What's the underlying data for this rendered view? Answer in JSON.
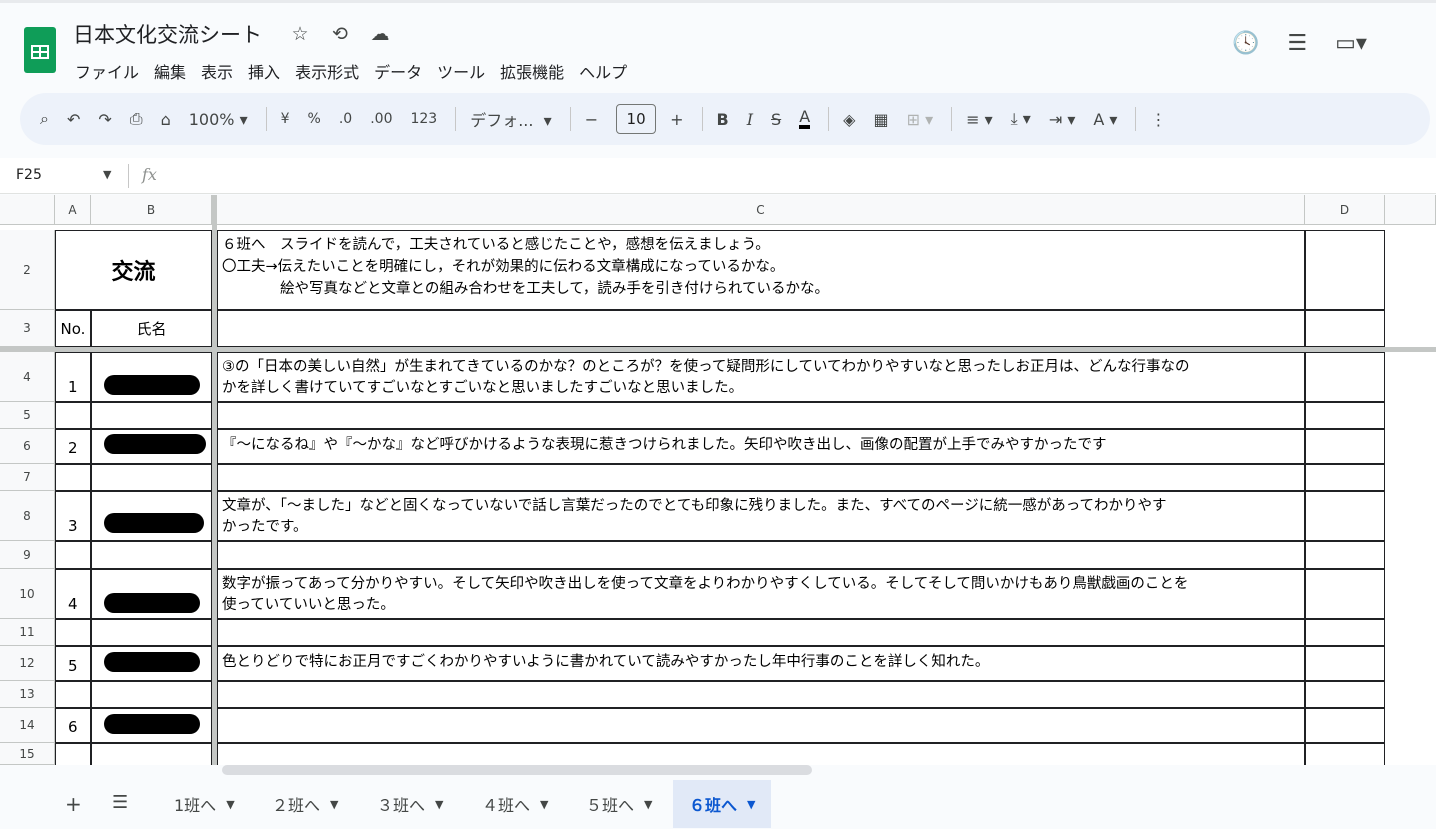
{
  "app": {
    "title": "日本文化交流シート",
    "icons": [
      "star-icon",
      "move-to-drive-icon",
      "cloud-status-icon"
    ]
  },
  "menu": [
    "ファイル",
    "編集",
    "表示",
    "挿入",
    "表示形式",
    "データ",
    "ツール",
    "拡張機能",
    "ヘルプ"
  ],
  "toolbar": {
    "zoom": "100%",
    "currency": "¥",
    "percent": "%",
    "dec_decrease": ".0",
    "dec_increase": ".00",
    "format_123": "123",
    "font": "デフォ...",
    "font_size": "10",
    "minus": "−",
    "plus": "+",
    "bold": "B",
    "italic": "I",
    "strike": "S",
    "text_color": "A"
  },
  "formula_bar": {
    "cell_ref": "F25",
    "fx": "fx"
  },
  "columns": [
    "A",
    "B",
    "C",
    "D"
  ],
  "rows": [
    "2",
    "3",
    "4",
    "5",
    "6",
    "7",
    "8",
    "9",
    "10",
    "11",
    "12",
    "13",
    "14",
    "15"
  ],
  "sheet": {
    "header_title": "交流",
    "instructions_line1": "６班へ　スライドを読んで，工夫されていると感じたことや，感想を伝えましょう。",
    "instructions_line2": "〇工夫→伝えたいことを明確にし，それが効果的に伝わる文章構成になっているかな。",
    "instructions_line3": "　　　　絵や写真などと文章との組み合わせを工夫して，読み手を引き付けられているかな。",
    "col_no": "No.",
    "col_name": "氏名",
    "entries": [
      {
        "no": "1",
        "line1": "③の「日本の美しい自然」が生まれてきているのかな？のところが？を使って疑問形にしていてわかりやすいなと思ったしお正月は、どんな行事なの",
        "line2": "かを詳しく書けていてすごいなとすごいなと思いましたすごいなと思いました。"
      },
      {
        "no": "2",
        "line1": "『〜になるね』や『〜かな』など呼びかけるような表現に惹きつけられました。矢印や吹き出し、画像の配置が上手でみやすかったです",
        "line2": ""
      },
      {
        "no": "3",
        "line1": "文章が、「〜ました」などと固くなっていないで話し言葉だったのでとても印象に残りました。また、すべてのページに統一感があってわかりやす",
        "line2": "かったです。"
      },
      {
        "no": "4",
        "line1": "数字が振ってあって分かりやすい。そして矢印や吹き出しを使って文章をよりわかりやすくしている。そしてそして問いかけもあり鳥獣戯画のことを",
        "line2": "使っていていいと思った。"
      },
      {
        "no": "5",
        "line1": "色とりどりで特にお正月ですごくわかりやすいように書かれていて読みやすかったし年中行事のことを詳しく知れた。",
        "line2": ""
      },
      {
        "no": "6",
        "line1": "",
        "line2": ""
      }
    ]
  },
  "tabs": [
    {
      "label": "1班へ",
      "active": false
    },
    {
      "label": "２班へ",
      "active": false
    },
    {
      "label": "３班へ",
      "active": false
    },
    {
      "label": "４班へ",
      "active": false
    },
    {
      "label": "５班へ",
      "active": false
    },
    {
      "label": "６班へ",
      "active": true
    }
  ],
  "colors": {
    "brand": "#0f9d58",
    "active_tab": "#0b57d0",
    "toolbar_bg": "#edf2fa"
  }
}
